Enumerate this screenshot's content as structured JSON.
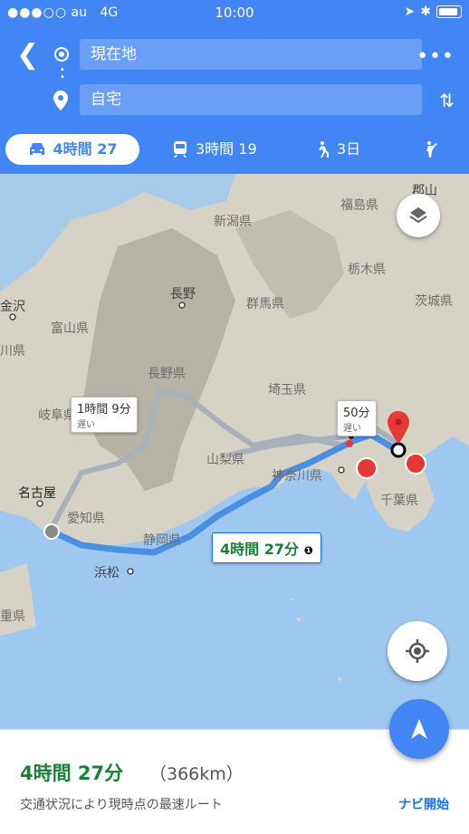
{
  "status_bar": {
    "carrier": "au",
    "network": "4G",
    "time": "10:00",
    "signal_dots": "●●●○○"
  },
  "route": {
    "origin": "現在地",
    "destination": "自宅"
  },
  "modes": [
    {
      "label": "4時間 27",
      "icon": "car-icon"
    },
    {
      "label": "3時間 19",
      "icon": "train-icon"
    },
    {
      "label": "3日",
      "icon": "walk-icon"
    },
    {
      "label": "",
      "icon": "ride-icon"
    }
  ],
  "map": {
    "labels": {
      "niigata": "新潟県",
      "fukushima": "福島県",
      "gunma": "群馬県",
      "tochigi": "栃木県",
      "ibaraki": "茨城県",
      "nagano_city": "長野",
      "nagano": "長野県",
      "toyama": "富山県",
      "kanazawa": "金沢",
      "gifu": "岐阜県",
      "yamanashi": "山梨県",
      "saitama": "埼玉県",
      "kanagawa": "神奈川県",
      "chiba": "千葉県",
      "nagoya": "名古屋",
      "aichi": "愛知県",
      "shizuoka": "静岡県",
      "hamamatsu": "浜松",
      "left_edge1": "川県",
      "left_edge2": "重県",
      "koriyama": "郡山"
    },
    "alt_route_1": {
      "time": "1時間 9分",
      "note": "遅い"
    },
    "alt_route_2": {
      "time": "50分",
      "note": "遅い"
    },
    "main_route": {
      "time": "4時間 27分"
    }
  },
  "summary": {
    "time": "4時間 27分",
    "distance": "（366km）",
    "note": "交通状況により現時点の最速ルート",
    "navi": "ナビ開始"
  },
  "colors": {
    "primary": "#4285f4",
    "route": "#4a90e2",
    "alt_route": "#a7b0bb",
    "green": "#188038"
  }
}
